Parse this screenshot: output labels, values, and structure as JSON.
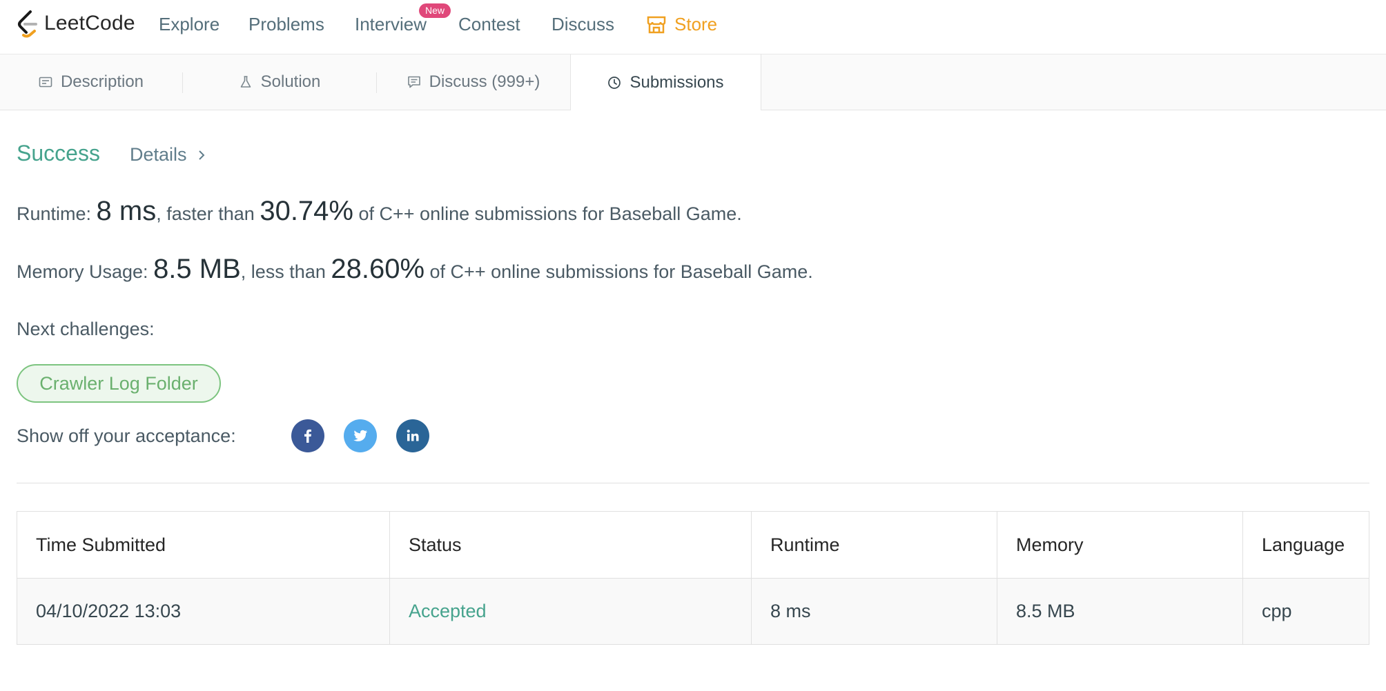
{
  "nav": {
    "logo_text": "LeetCode",
    "items": [
      "Explore",
      "Problems",
      "Interview",
      "Contest",
      "Discuss"
    ],
    "badge": "New",
    "store": "Store",
    "store_color": "#f0a020"
  },
  "tabs": [
    {
      "label": "Description",
      "icon": "description-icon"
    },
    {
      "label": "Solution",
      "icon": "flask-icon"
    },
    {
      "label": "Discuss (999+)",
      "icon": "comment-icon"
    },
    {
      "label": "Submissions",
      "icon": "clock-icon",
      "active": true
    }
  ],
  "result": {
    "status": "Success",
    "details": "Details",
    "runtime": {
      "label": "Runtime: ",
      "value": "8 ms",
      "mid": ", faster than ",
      "percent": "30.74%",
      "suffix": " of C++ online submissions for Baseball Game."
    },
    "memory": {
      "label": "Memory Usage: ",
      "value": "8.5 MB",
      "mid": ", less than ",
      "percent": "28.60%",
      "suffix": " of C++ online submissions for Baseball Game."
    },
    "next_label": "Next challenges:",
    "next_challenge": "Crawler Log Folder",
    "share_label": "Show off your acceptance:",
    "share": [
      "facebook-icon",
      "twitter-icon",
      "linkedin-icon"
    ]
  },
  "table": {
    "headers": [
      "Time Submitted",
      "Status",
      "Runtime",
      "Memory",
      "Language"
    ],
    "rows": [
      [
        "04/10/2022 13:03",
        "Accepted",
        "8 ms",
        "8.5 MB",
        "cpp"
      ]
    ]
  },
  "colors": {
    "success": "#46a38d",
    "challenge_border": "#7cc47f",
    "facebook": "#3b5998",
    "twitter": "#55acee",
    "linkedin": "#2a6597",
    "badge": "#e0487a"
  }
}
